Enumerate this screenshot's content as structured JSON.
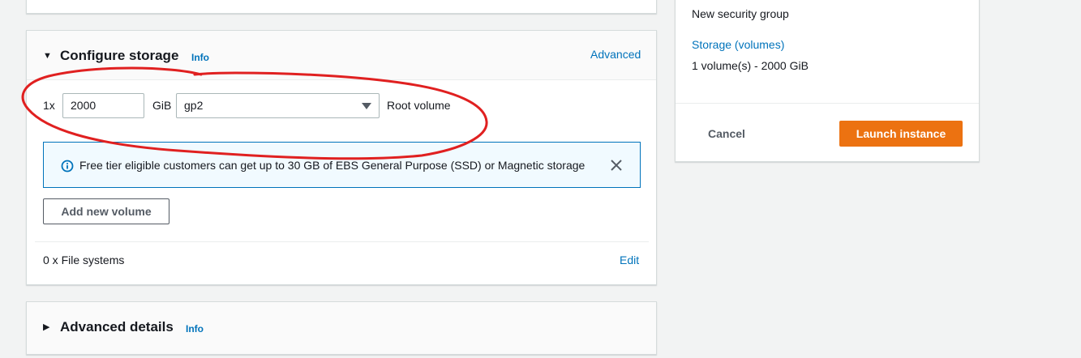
{
  "storage": {
    "title": "Configure storage",
    "info_label": "Info",
    "advanced_label": "Advanced",
    "volume_count": "1x",
    "size_value": "2000",
    "size_unit": "GiB",
    "volume_type": "gp2",
    "volume_role": "Root volume",
    "alert_text": "Free tier eligible customers can get up to 30 GB of EBS General Purpose (SSD) or Magnetic storage",
    "add_volume_label": "Add new volume",
    "file_systems_text": "0 x File systems",
    "edit_label": "Edit"
  },
  "advanced_details": {
    "title": "Advanced details",
    "info_label": "Info"
  },
  "summary": {
    "security_group_text": "New security group",
    "storage_link": "Storage (volumes)",
    "storage_value": "1 volume(s) - 2000 GiB",
    "cancel_label": "Cancel",
    "launch_label": "Launch instance"
  },
  "colors": {
    "accent_link": "#0073bb",
    "launch_button": "#ec7211",
    "annotation_stroke": "#e02020",
    "alert_background": "#f1faff"
  }
}
